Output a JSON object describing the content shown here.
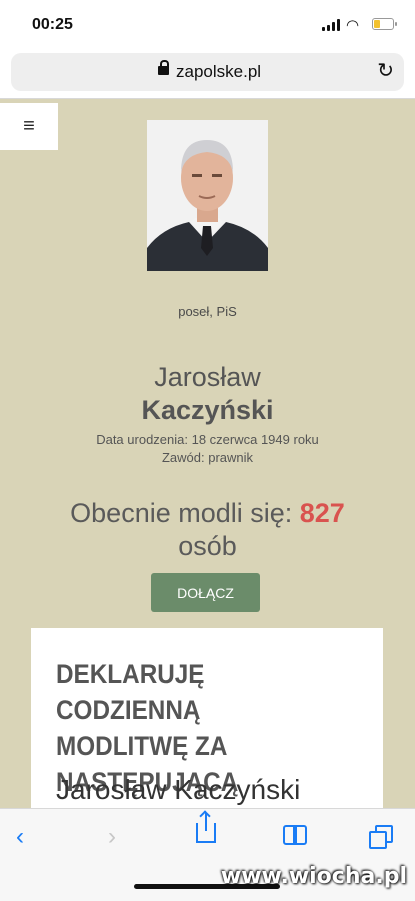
{
  "status_bar": {
    "time": "00:25"
  },
  "browser": {
    "url": "zapolske.pl"
  },
  "profile": {
    "party": "poseł, PiS",
    "first_name": "Jarosław",
    "last_name": "Kaczyński",
    "birth": "Data urodzenia: 18 czerwca 1949 roku",
    "job": "Zawód: prawnik"
  },
  "prayer": {
    "prefix": "Obecnie modli się: ",
    "count": "827",
    "suffix": "osób",
    "join_label": "DOŁĄCZ"
  },
  "declaration": {
    "heading": "DEKLARUJĘ CODZIENNĄ MODLITWĘ ZA NASTĘPUJĄCĄ OSOBĘ:",
    "name": "Jarosław Kaczyński"
  },
  "toolbar": {
    "back_icon": "chevron-left-icon",
    "forward_icon": "chevron-right-icon",
    "share_icon": "share-icon",
    "bookmarks_icon": "book-icon",
    "tabs_icon": "tabs-icon"
  },
  "watermark": "www.wiocha.pl",
  "colors": {
    "page_bg": "#d9d4b7",
    "accent_count": "#d9534f",
    "join_button": "#6b8c6a",
    "ios_blue": "#1a7cf5"
  }
}
